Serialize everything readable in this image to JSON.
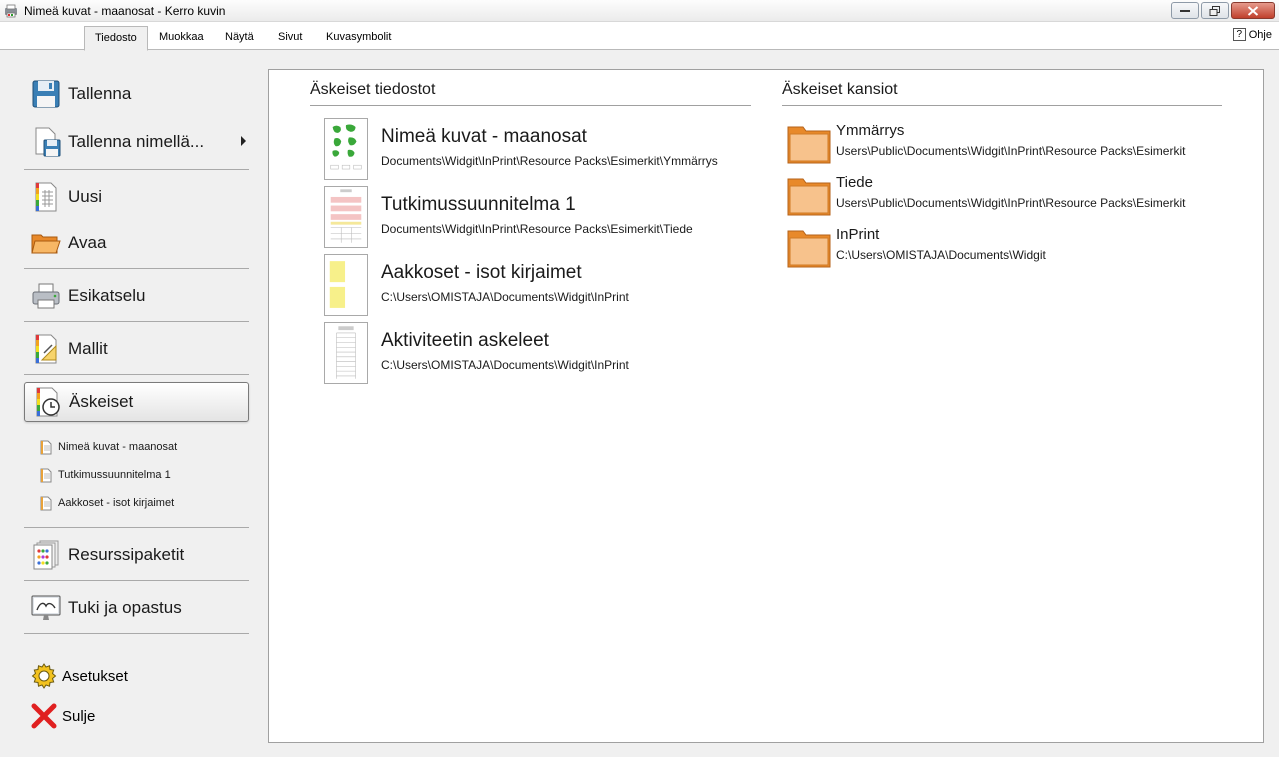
{
  "window": {
    "title": "Nimeä kuvat - maanosat - Kerro kuvin"
  },
  "menu": {
    "tabs": [
      {
        "label": "Tiedosto",
        "active": true
      },
      {
        "label": "Muokkaa"
      },
      {
        "label": "Näytä"
      },
      {
        "label": "Sivut"
      },
      {
        "label": "Kuvasymbolit"
      }
    ],
    "help_label": "Ohje"
  },
  "nav": {
    "save": "Tallenna",
    "save_as": "Tallenna nimellä...",
    "new": "Uusi",
    "open": "Avaa",
    "preview": "Esikatselu",
    "templates": "Mallit",
    "recent": "Äskeiset",
    "recent_items": [
      "Nimeä kuvat - maanosat",
      "Tutkimussuunnitelma 1",
      "Aakkoset - isot kirjaimet"
    ],
    "resource_packs": "Resurssipaketit",
    "support": "Tuki ja opastus",
    "settings": "Asetukset",
    "close": "Sulje"
  },
  "recent_files": {
    "heading": "Äskeiset tiedostot",
    "items": [
      {
        "name": "Nimeä kuvat - maanosat",
        "path": "Documents\\Widgit\\InPrint\\Resource Packs\\Esimerkit\\Ymmärrys"
      },
      {
        "name": "Tutkimussuunnitelma 1",
        "path": "Documents\\Widgit\\InPrint\\Resource Packs\\Esimerkit\\Tiede"
      },
      {
        "name": "Aakkoset - isot kirjaimet",
        "path": "C:\\Users\\OMISTAJA\\Documents\\Widgit\\InPrint"
      },
      {
        "name": "Aktiviteetin askeleet",
        "path": "C:\\Users\\OMISTAJA\\Documents\\Widgit\\InPrint"
      }
    ]
  },
  "recent_folders": {
    "heading": "Äskeiset kansiot",
    "items": [
      {
        "name": "Ymmärrys",
        "path": "Users\\Public\\Documents\\Widgit\\InPrint\\Resource Packs\\Esimerkit"
      },
      {
        "name": "Tiede",
        "path": "Users\\Public\\Documents\\Widgit\\InPrint\\Resource Packs\\Esimerkit"
      },
      {
        "name": "InPrint",
        "path": "C:\\Users\\OMISTAJA\\Documents\\Widgit"
      }
    ]
  },
  "colors": {
    "folder_orange": "#f0963c",
    "selected_border": "#7a7a7a",
    "panel_bg": "#ffffff",
    "chrome_bg": "#f0f0f0"
  }
}
